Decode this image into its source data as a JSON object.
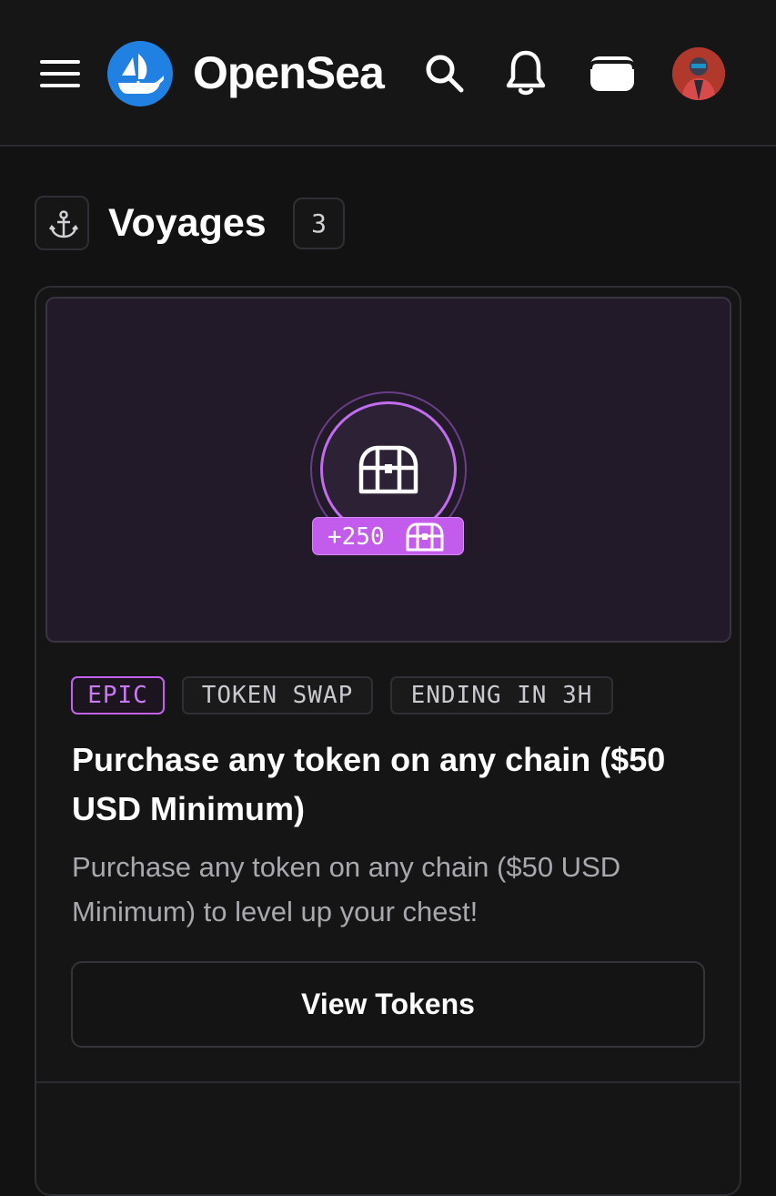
{
  "header": {
    "brand": "OpenSea",
    "menu_icon": "hamburger-menu-icon",
    "logo_icon": "opensea-ship-logo",
    "search_icon": "search-icon",
    "notifications_icon": "bell-icon",
    "wallet_icon": "wallet-icon",
    "avatar": "user-avatar"
  },
  "section": {
    "icon": "anchor-icon",
    "title": "Voyages",
    "count": "3"
  },
  "voyage": {
    "image_icon": "treasure-chest-icon",
    "reward": "+250",
    "reward_icon": "treasure-chest-icon",
    "tags": {
      "rarity": "EPIC",
      "type": "TOKEN SWAP",
      "time": "ENDING IN 3H"
    },
    "title": "Purchase any token on any chain ($50 USD Minimum)",
    "description": "Purchase any token on any chain ($50 USD Minimum) to level up your chest!",
    "button_label": "View Tokens"
  },
  "colors": {
    "background": "#121212",
    "accent_purple": "#c35cec",
    "brand_blue": "#2081e2",
    "muted_text": "#a8a8ae"
  }
}
